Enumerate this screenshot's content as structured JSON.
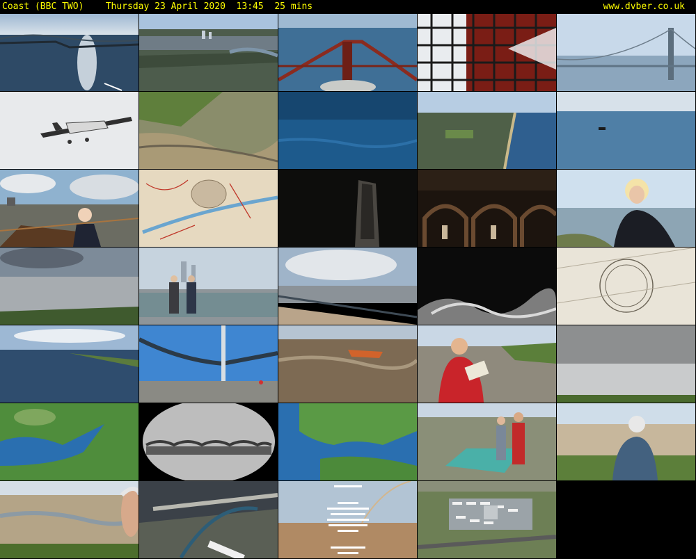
{
  "header": {
    "title": "Coast (BBC TWO)    Thursday 23 April 2020  13:45  25 mins",
    "site": "www.dvber.co.uk"
  },
  "thumbnails": [
    {
      "name": "thumb-forth-bridges-aerial",
      "icon": "bridge-icon"
    },
    {
      "name": "thumb-city-aerial",
      "icon": "city-icon"
    },
    {
      "name": "thumb-forth-bridge-span",
      "icon": "bridge-icon"
    },
    {
      "name": "thumb-bridge-girders-closeup",
      "icon": "girder-icon"
    },
    {
      "name": "thumb-suspension-bridge",
      "icon": "bridge-icon"
    },
    {
      "name": "thumb-small-plane",
      "icon": "plane-icon"
    },
    {
      "name": "thumb-tidal-flats",
      "icon": "landscape-icon"
    },
    {
      "name": "thumb-open-sea",
      "icon": "sea-icon"
    },
    {
      "name": "thumb-coastal-town-aerial",
      "icon": "town-icon"
    },
    {
      "name": "thumb-ship-at-sea",
      "icon": "ship-icon"
    },
    {
      "name": "thumb-rowing-boat-presenter",
      "icon": "boat-icon"
    },
    {
      "name": "thumb-old-map",
      "icon": "map-icon"
    },
    {
      "name": "thumb-dark-tunnel",
      "icon": "tunnel-icon"
    },
    {
      "name": "thumb-brick-vaults",
      "icon": "vault-icon"
    },
    {
      "name": "thumb-presenter-riverside",
      "icon": "person-icon"
    },
    {
      "name": "thumb-stormy-estuary",
      "icon": "estuary-icon"
    },
    {
      "name": "thumb-walkers-promenade",
      "icon": "people-icon"
    },
    {
      "name": "thumb-riverside-promenade",
      "icon": "promenade-icon"
    },
    {
      "name": "thumb-crashing-waves",
      "icon": "wave-icon"
    },
    {
      "name": "thumb-old-chart-drawing",
      "icon": "chart-icon"
    },
    {
      "name": "thumb-calm-estuary",
      "icon": "estuary-icon"
    },
    {
      "name": "thumb-severn-bridge",
      "icon": "bridge-icon"
    },
    {
      "name": "thumb-rescue-boat",
      "icon": "lifeboat-icon"
    },
    {
      "name": "thumb-man-with-book",
      "icon": "person-icon"
    },
    {
      "name": "thumb-silver-sea",
      "icon": "sea-icon"
    },
    {
      "name": "thumb-satellite-map",
      "icon": "globe-icon"
    },
    {
      "name": "thumb-bridge-through-lens",
      "icon": "binoculars-icon"
    },
    {
      "name": "thumb-satellite-map-2",
      "icon": "globe-icon"
    },
    {
      "name": "thumb-men-with-model",
      "icon": "people-icon"
    },
    {
      "name": "thumb-man-on-shore",
      "icon": "person-icon"
    },
    {
      "name": "thumb-mudflats-man",
      "icon": "person-icon"
    },
    {
      "name": "thumb-tyne-bridges",
      "icon": "bridge-icon"
    },
    {
      "name": "thumb-end-credits",
      "icon": "credits-icon"
    },
    {
      "name": "thumb-airport-aerial",
      "icon": "airport-icon"
    }
  ]
}
